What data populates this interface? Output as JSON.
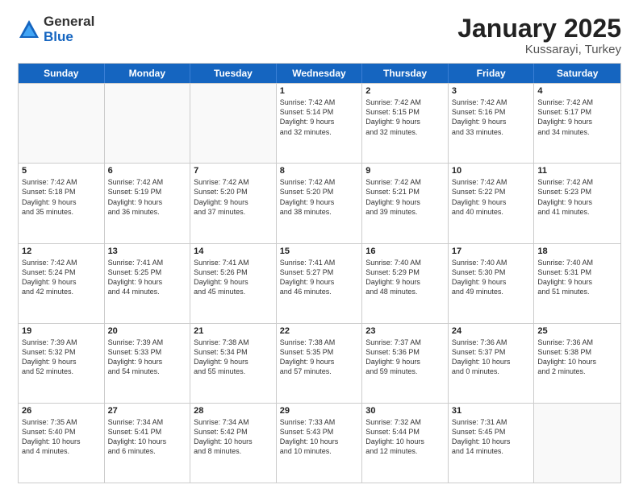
{
  "logo": {
    "general": "General",
    "blue": "Blue"
  },
  "title": "January 2025",
  "location": "Kussarayi, Turkey",
  "days": [
    "Sunday",
    "Monday",
    "Tuesday",
    "Wednesday",
    "Thursday",
    "Friday",
    "Saturday"
  ],
  "weeks": [
    [
      {
        "day": "",
        "info": []
      },
      {
        "day": "",
        "info": []
      },
      {
        "day": "",
        "info": []
      },
      {
        "day": "1",
        "info": [
          "Sunrise: 7:42 AM",
          "Sunset: 5:14 PM",
          "Daylight: 9 hours",
          "and 32 minutes."
        ]
      },
      {
        "day": "2",
        "info": [
          "Sunrise: 7:42 AM",
          "Sunset: 5:15 PM",
          "Daylight: 9 hours",
          "and 32 minutes."
        ]
      },
      {
        "day": "3",
        "info": [
          "Sunrise: 7:42 AM",
          "Sunset: 5:16 PM",
          "Daylight: 9 hours",
          "and 33 minutes."
        ]
      },
      {
        "day": "4",
        "info": [
          "Sunrise: 7:42 AM",
          "Sunset: 5:17 PM",
          "Daylight: 9 hours",
          "and 34 minutes."
        ]
      }
    ],
    [
      {
        "day": "5",
        "info": [
          "Sunrise: 7:42 AM",
          "Sunset: 5:18 PM",
          "Daylight: 9 hours",
          "and 35 minutes."
        ]
      },
      {
        "day": "6",
        "info": [
          "Sunrise: 7:42 AM",
          "Sunset: 5:19 PM",
          "Daylight: 9 hours",
          "and 36 minutes."
        ]
      },
      {
        "day": "7",
        "info": [
          "Sunrise: 7:42 AM",
          "Sunset: 5:20 PM",
          "Daylight: 9 hours",
          "and 37 minutes."
        ]
      },
      {
        "day": "8",
        "info": [
          "Sunrise: 7:42 AM",
          "Sunset: 5:20 PM",
          "Daylight: 9 hours",
          "and 38 minutes."
        ]
      },
      {
        "day": "9",
        "info": [
          "Sunrise: 7:42 AM",
          "Sunset: 5:21 PM",
          "Daylight: 9 hours",
          "and 39 minutes."
        ]
      },
      {
        "day": "10",
        "info": [
          "Sunrise: 7:42 AM",
          "Sunset: 5:22 PM",
          "Daylight: 9 hours",
          "and 40 minutes."
        ]
      },
      {
        "day": "11",
        "info": [
          "Sunrise: 7:42 AM",
          "Sunset: 5:23 PM",
          "Daylight: 9 hours",
          "and 41 minutes."
        ]
      }
    ],
    [
      {
        "day": "12",
        "info": [
          "Sunrise: 7:42 AM",
          "Sunset: 5:24 PM",
          "Daylight: 9 hours",
          "and 42 minutes."
        ]
      },
      {
        "day": "13",
        "info": [
          "Sunrise: 7:41 AM",
          "Sunset: 5:25 PM",
          "Daylight: 9 hours",
          "and 44 minutes."
        ]
      },
      {
        "day": "14",
        "info": [
          "Sunrise: 7:41 AM",
          "Sunset: 5:26 PM",
          "Daylight: 9 hours",
          "and 45 minutes."
        ]
      },
      {
        "day": "15",
        "info": [
          "Sunrise: 7:41 AM",
          "Sunset: 5:27 PM",
          "Daylight: 9 hours",
          "and 46 minutes."
        ]
      },
      {
        "day": "16",
        "info": [
          "Sunrise: 7:40 AM",
          "Sunset: 5:29 PM",
          "Daylight: 9 hours",
          "and 48 minutes."
        ]
      },
      {
        "day": "17",
        "info": [
          "Sunrise: 7:40 AM",
          "Sunset: 5:30 PM",
          "Daylight: 9 hours",
          "and 49 minutes."
        ]
      },
      {
        "day": "18",
        "info": [
          "Sunrise: 7:40 AM",
          "Sunset: 5:31 PM",
          "Daylight: 9 hours",
          "and 51 minutes."
        ]
      }
    ],
    [
      {
        "day": "19",
        "info": [
          "Sunrise: 7:39 AM",
          "Sunset: 5:32 PM",
          "Daylight: 9 hours",
          "and 52 minutes."
        ]
      },
      {
        "day": "20",
        "info": [
          "Sunrise: 7:39 AM",
          "Sunset: 5:33 PM",
          "Daylight: 9 hours",
          "and 54 minutes."
        ]
      },
      {
        "day": "21",
        "info": [
          "Sunrise: 7:38 AM",
          "Sunset: 5:34 PM",
          "Daylight: 9 hours",
          "and 55 minutes."
        ]
      },
      {
        "day": "22",
        "info": [
          "Sunrise: 7:38 AM",
          "Sunset: 5:35 PM",
          "Daylight: 9 hours",
          "and 57 minutes."
        ]
      },
      {
        "day": "23",
        "info": [
          "Sunrise: 7:37 AM",
          "Sunset: 5:36 PM",
          "Daylight: 9 hours",
          "and 59 minutes."
        ]
      },
      {
        "day": "24",
        "info": [
          "Sunrise: 7:36 AM",
          "Sunset: 5:37 PM",
          "Daylight: 10 hours",
          "and 0 minutes."
        ]
      },
      {
        "day": "25",
        "info": [
          "Sunrise: 7:36 AM",
          "Sunset: 5:38 PM",
          "Daylight: 10 hours",
          "and 2 minutes."
        ]
      }
    ],
    [
      {
        "day": "26",
        "info": [
          "Sunrise: 7:35 AM",
          "Sunset: 5:40 PM",
          "Daylight: 10 hours",
          "and 4 minutes."
        ]
      },
      {
        "day": "27",
        "info": [
          "Sunrise: 7:34 AM",
          "Sunset: 5:41 PM",
          "Daylight: 10 hours",
          "and 6 minutes."
        ]
      },
      {
        "day": "28",
        "info": [
          "Sunrise: 7:34 AM",
          "Sunset: 5:42 PM",
          "Daylight: 10 hours",
          "and 8 minutes."
        ]
      },
      {
        "day": "29",
        "info": [
          "Sunrise: 7:33 AM",
          "Sunset: 5:43 PM",
          "Daylight: 10 hours",
          "and 10 minutes."
        ]
      },
      {
        "day": "30",
        "info": [
          "Sunrise: 7:32 AM",
          "Sunset: 5:44 PM",
          "Daylight: 10 hours",
          "and 12 minutes."
        ]
      },
      {
        "day": "31",
        "info": [
          "Sunrise: 7:31 AM",
          "Sunset: 5:45 PM",
          "Daylight: 10 hours",
          "and 14 minutes."
        ]
      },
      {
        "day": "",
        "info": []
      }
    ]
  ]
}
